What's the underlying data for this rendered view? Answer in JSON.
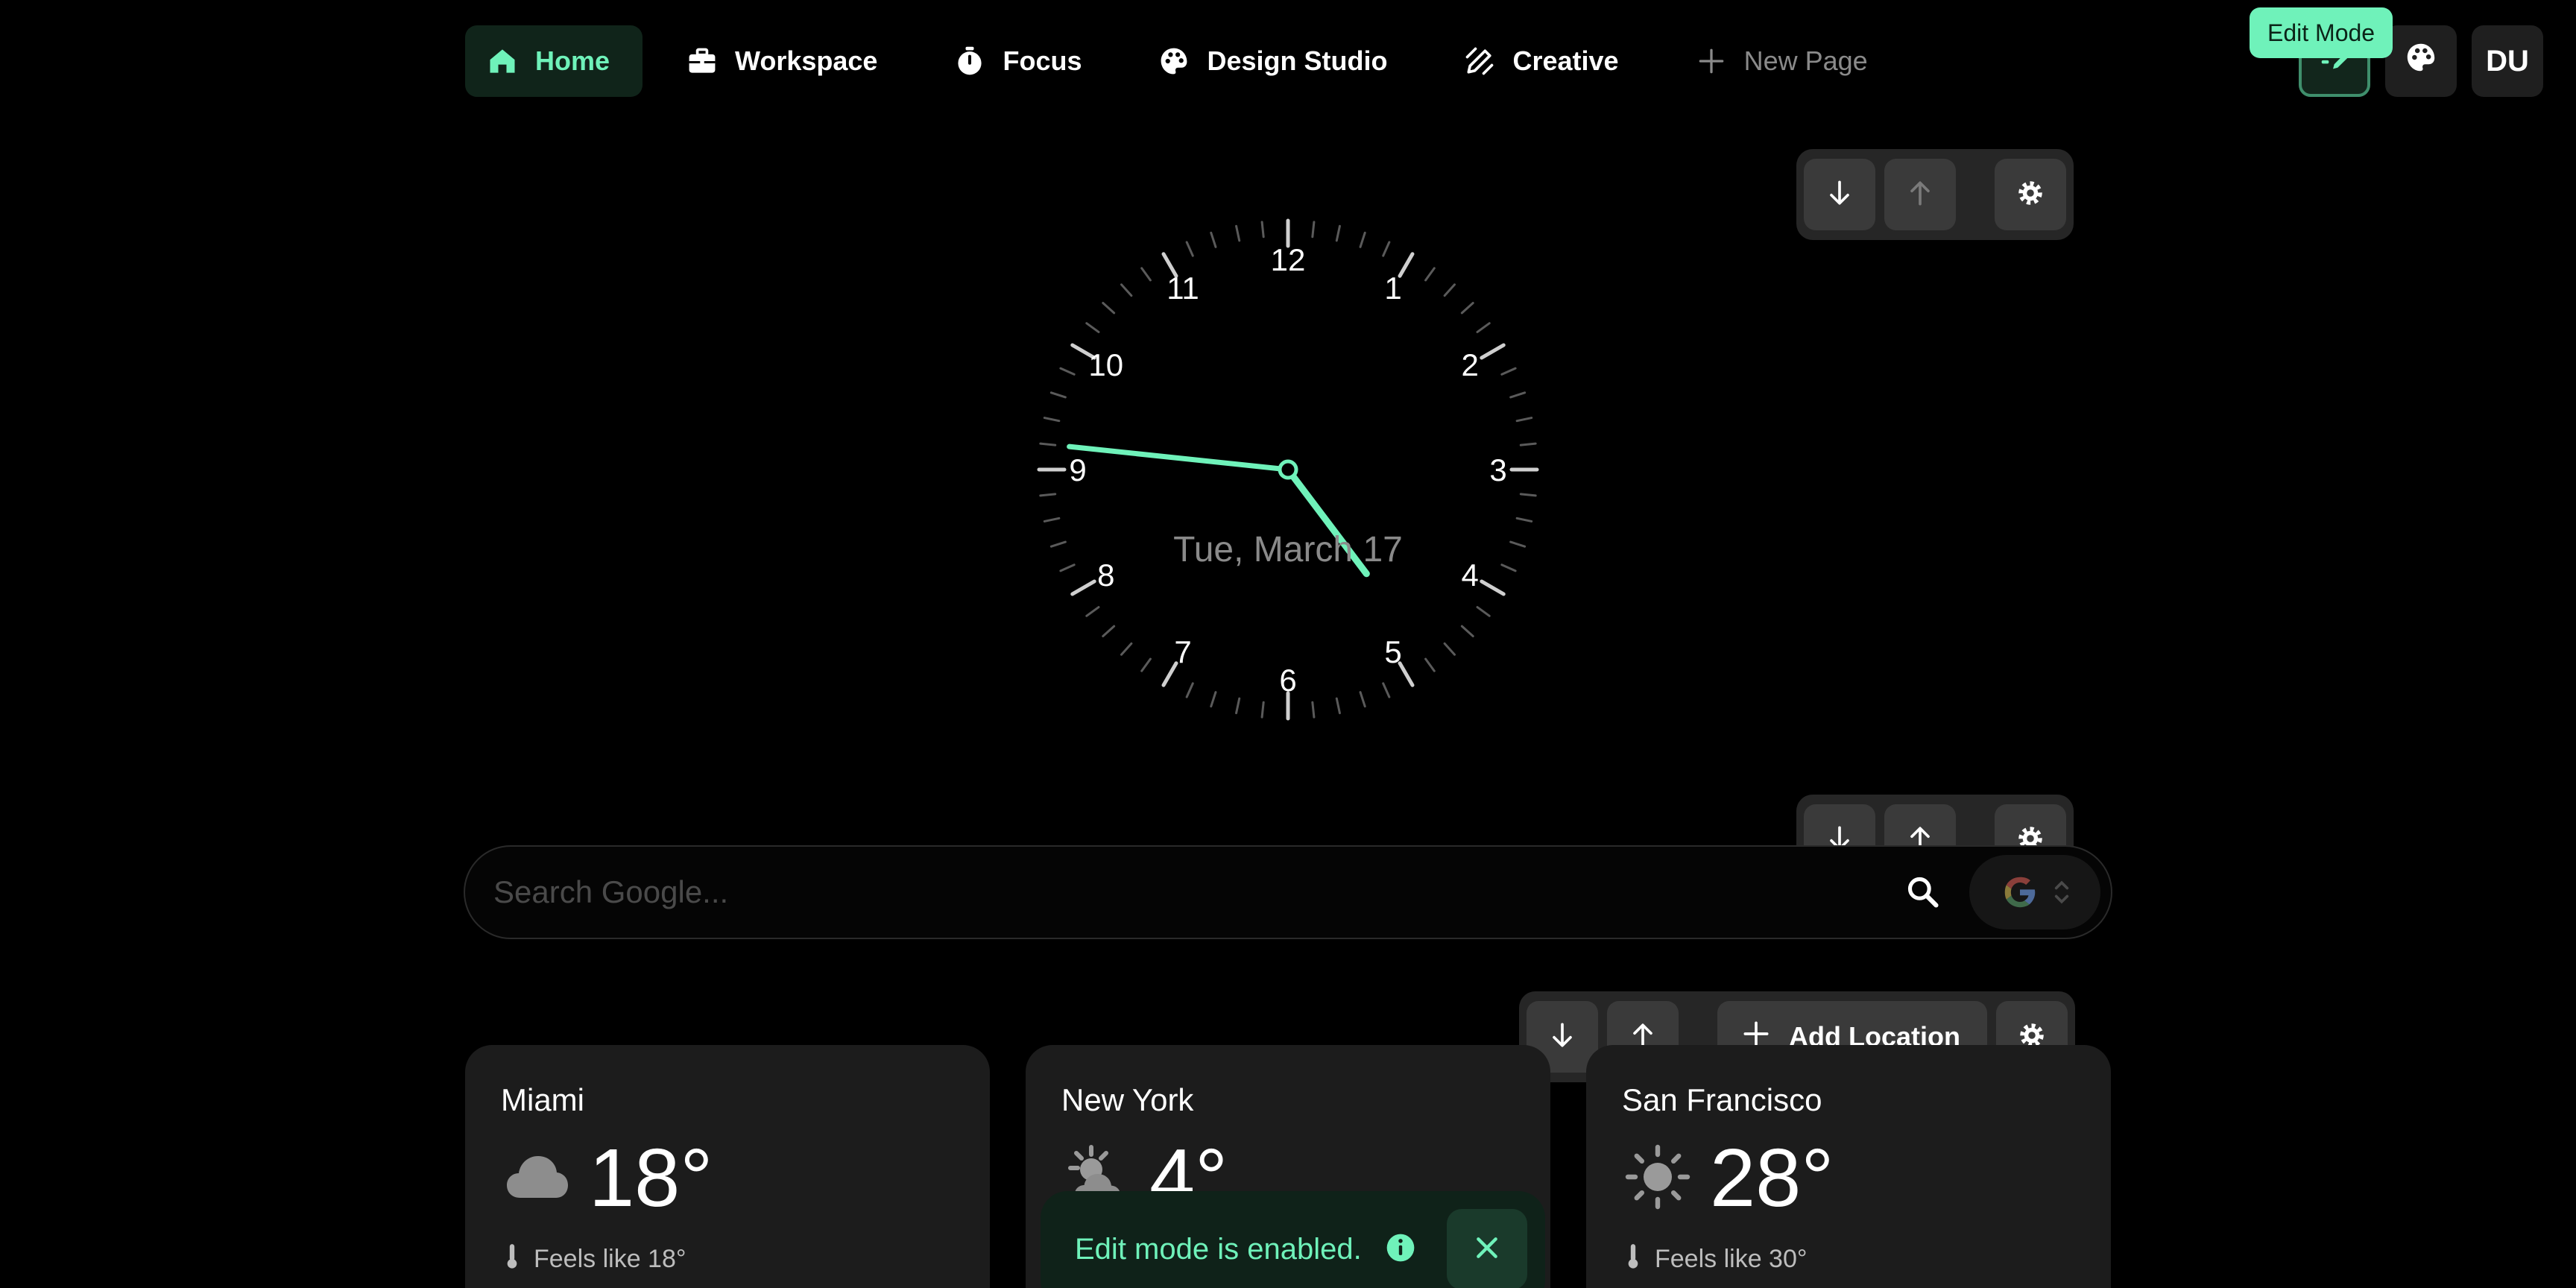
{
  "nav": {
    "tabs": [
      {
        "label": "Home",
        "icon": "home-icon",
        "active": true
      },
      {
        "label": "Workspace",
        "icon": "briefcase-icon"
      },
      {
        "label": "Focus",
        "icon": "stopwatch-icon"
      },
      {
        "label": "Design Studio",
        "icon": "palette-icon"
      },
      {
        "label": "Creative",
        "icon": "pen-ruler-icon"
      }
    ],
    "new_page_label": "New Page"
  },
  "header": {
    "tooltip": "Edit Mode",
    "avatar_initials": "DU"
  },
  "widget_controls": {
    "add_location_label": "Add Location"
  },
  "clock": {
    "numbers": [
      "12",
      "1",
      "2",
      "3",
      "4",
      "5",
      "6",
      "7",
      "8",
      "9",
      "10",
      "11"
    ],
    "hour": 4,
    "minute": 46,
    "date": "Tue, March 17",
    "accent_color": "#6ff2ba"
  },
  "search": {
    "placeholder": "Search Google...",
    "engine": "Google"
  },
  "weather": [
    {
      "city": "Miami",
      "temp": "18°",
      "condition": "cloud-icon",
      "feels_like": "Feels like 18°"
    },
    {
      "city": "New York",
      "temp": "4°",
      "condition": "sun-cloud-icon",
      "feels_like": ""
    },
    {
      "city": "San Francisco",
      "temp": "28°",
      "condition": "sun-icon",
      "feels_like": "Feels like 30°"
    }
  ],
  "toast": {
    "message": "Edit mode is enabled."
  },
  "colors": {
    "accent": "#6ff2ba",
    "background": "#000000",
    "card": "#1c1c1c"
  }
}
